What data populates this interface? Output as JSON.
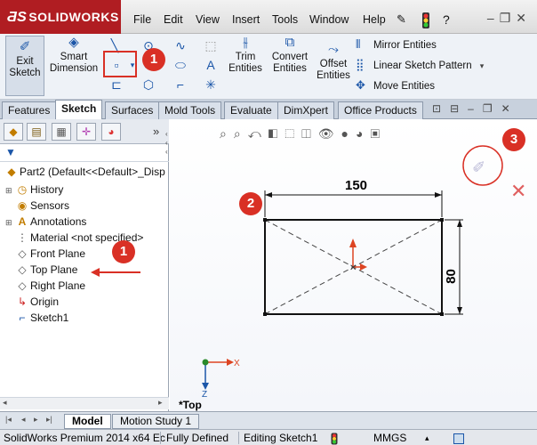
{
  "app": {
    "name": "SOLIDWORKS"
  },
  "menu": [
    "File",
    "Edit",
    "View",
    "Insert",
    "Tools",
    "Window",
    "Help"
  ],
  "commands": {
    "exit_sketch": "Exit\nSketch",
    "smart_dimension": "Smart\nDimension",
    "trim_entities": "Trim\nEntities",
    "convert_entities": "Convert\nEntities",
    "offset_entities": "Offset\nEntities",
    "mirror_entities": "Mirror Entities",
    "linear_sketch_pattern": "Linear Sketch Pattern",
    "move_entities": "Move Entities"
  },
  "tabs": [
    "Features",
    "Sketch",
    "Surfaces",
    "Mold Tools",
    "Evaluate",
    "DimXpert",
    "Office Products"
  ],
  "active_tab": "Sketch",
  "tree": {
    "root": "Part2  (Default<<Default>_Disp",
    "items": [
      "History",
      "Sensors",
      "Annotations",
      "Material <not specified>",
      "Front Plane",
      "Top Plane",
      "Right Plane",
      "Origin",
      "Sketch1"
    ]
  },
  "dimensions": {
    "horizontal": "150",
    "vertical": "80"
  },
  "view_label": "*Top",
  "badges": [
    "1",
    "1",
    "2",
    "3"
  ],
  "bottom_tabs": [
    "Model",
    "Motion Study 1"
  ],
  "status": {
    "product": "SolidWorks Premium 2014 x64 Ec",
    "definition": "Fully Defined",
    "editing": "Editing Sketch1",
    "units": "MMGS"
  },
  "colors": {
    "brand": "#b01d22",
    "badge": "#d93025",
    "accent": "#1b56a8"
  }
}
